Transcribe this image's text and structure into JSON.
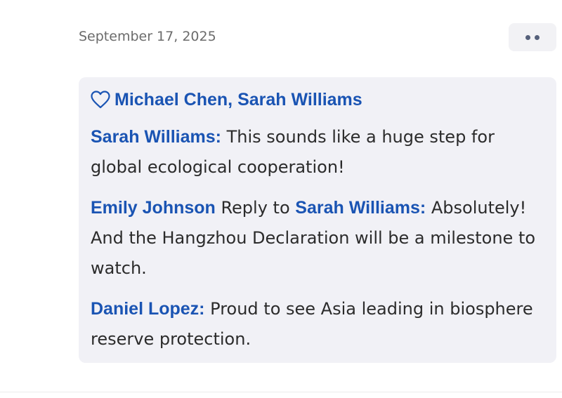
{
  "post": {
    "date": "September 17, 2025"
  },
  "more_button": {
    "icon": "more-dots-icon"
  },
  "likes": {
    "icon": "heart-outline-icon",
    "names": [
      "Michael Chen",
      "Sarah Williams"
    ],
    "separator": ", "
  },
  "comments": [
    {
      "author": "Sarah Williams:",
      "text": " This sounds like a huge step for global ecological cooperation!"
    },
    {
      "author": "Emily Johnson",
      "reply_word": " Reply to ",
      "reply_to": "Sarah Williams:",
      "text": " Absolutely! And the Hangzhou Declaration will be a milestone to watch."
    },
    {
      "author": "Daniel Lopez:",
      "text": " Proud to see Asia leading in biosphere reserve protection."
    }
  ],
  "colors": {
    "link": "#1a54b3",
    "panel_bg": "#f1f1f6",
    "text": "#2b2b2b",
    "muted": "#6b6b6b"
  }
}
